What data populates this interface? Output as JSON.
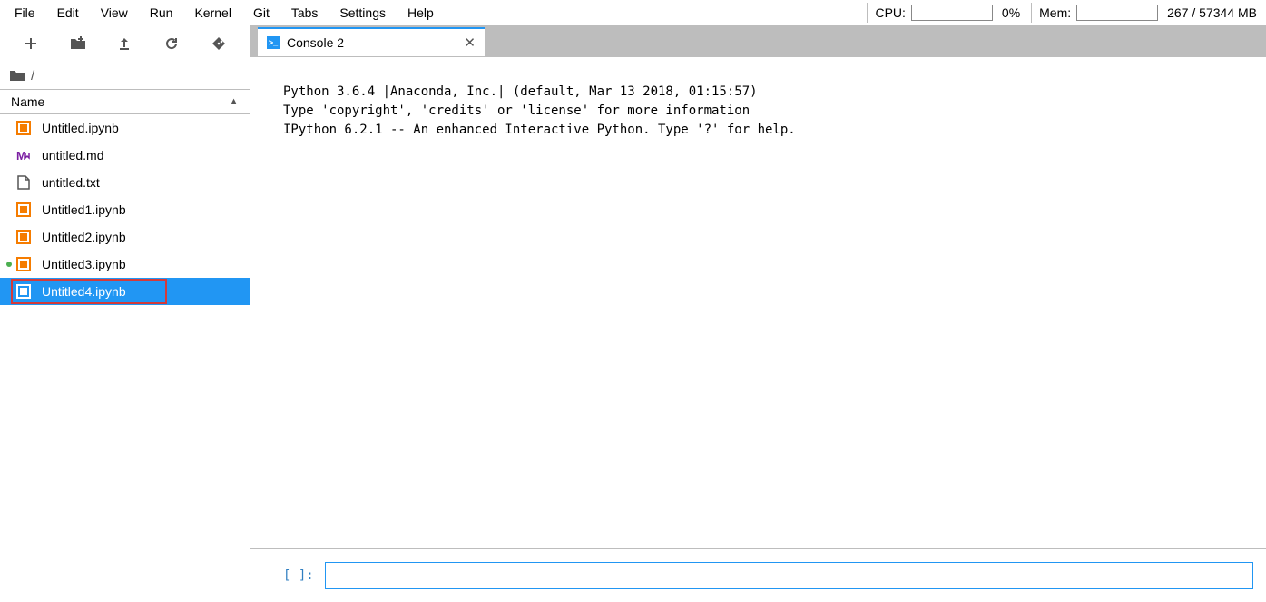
{
  "menu": {
    "items": [
      "File",
      "Edit",
      "View",
      "Run",
      "Kernel",
      "Git",
      "Tabs",
      "Settings",
      "Help"
    ]
  },
  "status": {
    "cpu_label": "CPU:",
    "cpu_value": "0%",
    "mem_label": "Mem:",
    "mem_value": "267 / 57344 MB"
  },
  "sidebar": {
    "breadcrumb_root": "/",
    "column_header": "Name",
    "files": [
      {
        "name": "Untitled.ipynb",
        "type": "notebook",
        "running": false,
        "selected": false
      },
      {
        "name": "untitled.md",
        "type": "markdown",
        "running": false,
        "selected": false
      },
      {
        "name": "untitled.txt",
        "type": "text",
        "running": false,
        "selected": false
      },
      {
        "name": "Untitled1.ipynb",
        "type": "notebook",
        "running": false,
        "selected": false
      },
      {
        "name": "Untitled2.ipynb",
        "type": "notebook",
        "running": false,
        "selected": false
      },
      {
        "name": "Untitled3.ipynb",
        "type": "notebook",
        "running": true,
        "selected": false
      },
      {
        "name": "Untitled4.ipynb",
        "type": "notebook",
        "running": false,
        "selected": true
      }
    ]
  },
  "tab": {
    "label": "Console 2",
    "icon_glyph": ">_"
  },
  "console": {
    "output_line1": "Python 3.6.4 |Anaconda, Inc.| (default, Mar 13 2018, 01:15:57) ",
    "output_line2": "Type 'copyright', 'credits' or 'license' for more information",
    "output_line3": "IPython 6.2.1 -- An enhanced Interactive Python. Type '?' for help.",
    "prompt": "[ ]:"
  }
}
